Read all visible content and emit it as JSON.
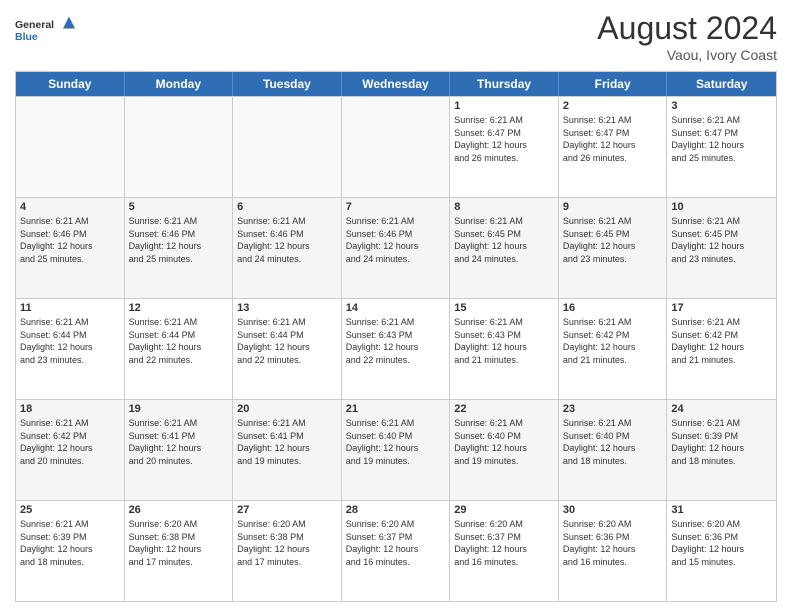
{
  "header": {
    "logo_general": "General",
    "logo_blue": "Blue",
    "month_year": "August 2024",
    "location": "Vaou, Ivory Coast"
  },
  "days_of_week": [
    "Sunday",
    "Monday",
    "Tuesday",
    "Wednesday",
    "Thursday",
    "Friday",
    "Saturday"
  ],
  "rows": [
    [
      {
        "day": "",
        "info": ""
      },
      {
        "day": "",
        "info": ""
      },
      {
        "day": "",
        "info": ""
      },
      {
        "day": "",
        "info": ""
      },
      {
        "day": "1",
        "info": "Sunrise: 6:21 AM\nSunset: 6:47 PM\nDaylight: 12 hours\nand 26 minutes."
      },
      {
        "day": "2",
        "info": "Sunrise: 6:21 AM\nSunset: 6:47 PM\nDaylight: 12 hours\nand 26 minutes."
      },
      {
        "day": "3",
        "info": "Sunrise: 6:21 AM\nSunset: 6:47 PM\nDaylight: 12 hours\nand 25 minutes."
      }
    ],
    [
      {
        "day": "4",
        "info": "Sunrise: 6:21 AM\nSunset: 6:46 PM\nDaylight: 12 hours\nand 25 minutes."
      },
      {
        "day": "5",
        "info": "Sunrise: 6:21 AM\nSunset: 6:46 PM\nDaylight: 12 hours\nand 25 minutes."
      },
      {
        "day": "6",
        "info": "Sunrise: 6:21 AM\nSunset: 6:46 PM\nDaylight: 12 hours\nand 24 minutes."
      },
      {
        "day": "7",
        "info": "Sunrise: 6:21 AM\nSunset: 6:46 PM\nDaylight: 12 hours\nand 24 minutes."
      },
      {
        "day": "8",
        "info": "Sunrise: 6:21 AM\nSunset: 6:45 PM\nDaylight: 12 hours\nand 24 minutes."
      },
      {
        "day": "9",
        "info": "Sunrise: 6:21 AM\nSunset: 6:45 PM\nDaylight: 12 hours\nand 23 minutes."
      },
      {
        "day": "10",
        "info": "Sunrise: 6:21 AM\nSunset: 6:45 PM\nDaylight: 12 hours\nand 23 minutes."
      }
    ],
    [
      {
        "day": "11",
        "info": "Sunrise: 6:21 AM\nSunset: 6:44 PM\nDaylight: 12 hours\nand 23 minutes."
      },
      {
        "day": "12",
        "info": "Sunrise: 6:21 AM\nSunset: 6:44 PM\nDaylight: 12 hours\nand 22 minutes."
      },
      {
        "day": "13",
        "info": "Sunrise: 6:21 AM\nSunset: 6:44 PM\nDaylight: 12 hours\nand 22 minutes."
      },
      {
        "day": "14",
        "info": "Sunrise: 6:21 AM\nSunset: 6:43 PM\nDaylight: 12 hours\nand 22 minutes."
      },
      {
        "day": "15",
        "info": "Sunrise: 6:21 AM\nSunset: 6:43 PM\nDaylight: 12 hours\nand 21 minutes."
      },
      {
        "day": "16",
        "info": "Sunrise: 6:21 AM\nSunset: 6:42 PM\nDaylight: 12 hours\nand 21 minutes."
      },
      {
        "day": "17",
        "info": "Sunrise: 6:21 AM\nSunset: 6:42 PM\nDaylight: 12 hours\nand 21 minutes."
      }
    ],
    [
      {
        "day": "18",
        "info": "Sunrise: 6:21 AM\nSunset: 6:42 PM\nDaylight: 12 hours\nand 20 minutes."
      },
      {
        "day": "19",
        "info": "Sunrise: 6:21 AM\nSunset: 6:41 PM\nDaylight: 12 hours\nand 20 minutes."
      },
      {
        "day": "20",
        "info": "Sunrise: 6:21 AM\nSunset: 6:41 PM\nDaylight: 12 hours\nand 19 minutes."
      },
      {
        "day": "21",
        "info": "Sunrise: 6:21 AM\nSunset: 6:40 PM\nDaylight: 12 hours\nand 19 minutes."
      },
      {
        "day": "22",
        "info": "Sunrise: 6:21 AM\nSunset: 6:40 PM\nDaylight: 12 hours\nand 19 minutes."
      },
      {
        "day": "23",
        "info": "Sunrise: 6:21 AM\nSunset: 6:40 PM\nDaylight: 12 hours\nand 18 minutes."
      },
      {
        "day": "24",
        "info": "Sunrise: 6:21 AM\nSunset: 6:39 PM\nDaylight: 12 hours\nand 18 minutes."
      }
    ],
    [
      {
        "day": "25",
        "info": "Sunrise: 6:21 AM\nSunset: 6:39 PM\nDaylight: 12 hours\nand 18 minutes."
      },
      {
        "day": "26",
        "info": "Sunrise: 6:20 AM\nSunset: 6:38 PM\nDaylight: 12 hours\nand 17 minutes."
      },
      {
        "day": "27",
        "info": "Sunrise: 6:20 AM\nSunset: 6:38 PM\nDaylight: 12 hours\nand 17 minutes."
      },
      {
        "day": "28",
        "info": "Sunrise: 6:20 AM\nSunset: 6:37 PM\nDaylight: 12 hours\nand 16 minutes."
      },
      {
        "day": "29",
        "info": "Sunrise: 6:20 AM\nSunset: 6:37 PM\nDaylight: 12 hours\nand 16 minutes."
      },
      {
        "day": "30",
        "info": "Sunrise: 6:20 AM\nSunset: 6:36 PM\nDaylight: 12 hours\nand 16 minutes."
      },
      {
        "day": "31",
        "info": "Sunrise: 6:20 AM\nSunset: 6:36 PM\nDaylight: 12 hours\nand 15 minutes."
      }
    ]
  ]
}
